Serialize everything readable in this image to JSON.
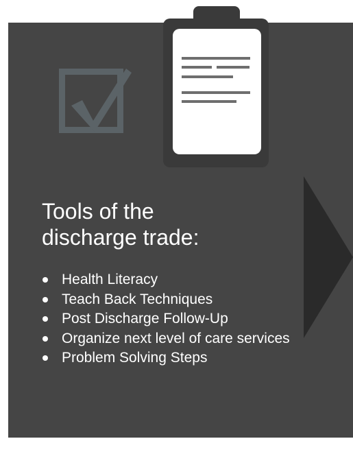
{
  "title_line1": "Tools of the",
  "title_line2": "discharge trade:",
  "items": [
    "Health Literacy",
    "Teach Back Techniques",
    "Post Discharge Follow-Up",
    "Organize next level of care services",
    "Problem Solving Steps"
  ],
  "icons": {
    "checkbox": "checkbox-icon",
    "clipboard": "clipboard-icon",
    "arrow": "arrow-right-icon"
  },
  "colors": {
    "panel": "#454545",
    "arrow": "#2a2a2a",
    "checkbox": "#5b6367",
    "clipboard": "#3a3a3a",
    "text": "#ffffff"
  }
}
